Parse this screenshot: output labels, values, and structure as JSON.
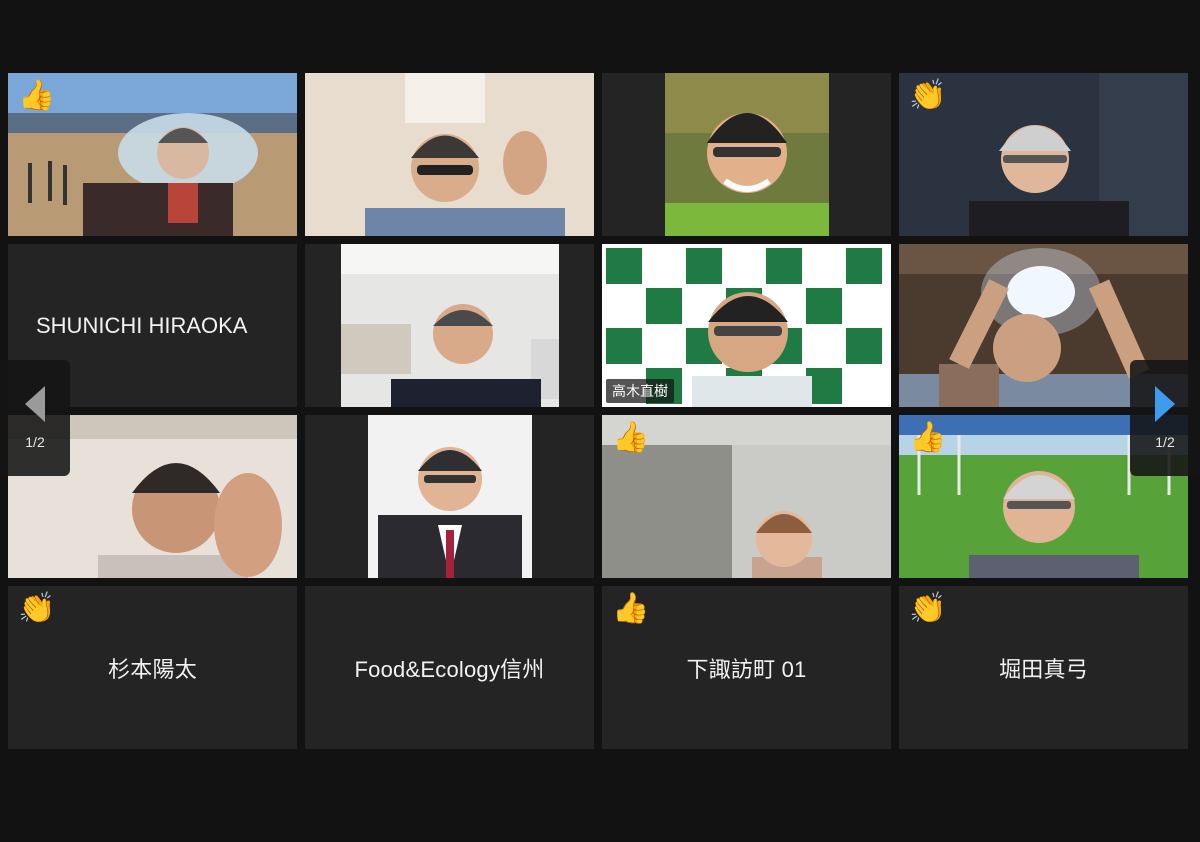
{
  "meeting": {
    "participants": {
      "p1": {
        "reaction": "👍"
      },
      "p2": {},
      "p3": {},
      "p4": {
        "reaction": "👏"
      },
      "p5": {
        "name": "SHUNICHI HIRAOKA"
      },
      "p6": {},
      "p7": {
        "name": "高木直樹",
        "active_speaker": true
      },
      "p8": {},
      "p9": {},
      "p10": {},
      "p11": {
        "reaction": "👍"
      },
      "p12": {
        "reaction": "👍"
      },
      "p13": {
        "name": "杉本陽太",
        "reaction": "👏"
      },
      "p14": {
        "name": "Food&Ecology信州"
      },
      "p15": {
        "name": "下諏訪町 01",
        "reaction": "👍"
      },
      "p16": {
        "name": "堀田真弓",
        "reaction": "👏"
      }
    },
    "pager": {
      "left_page": "1/2",
      "right_page": "1/2"
    },
    "colors": {
      "background": "#121212",
      "tile": "#242424",
      "active_border": "#d8ea6a",
      "next_arrow": "#3e9cf0"
    }
  }
}
